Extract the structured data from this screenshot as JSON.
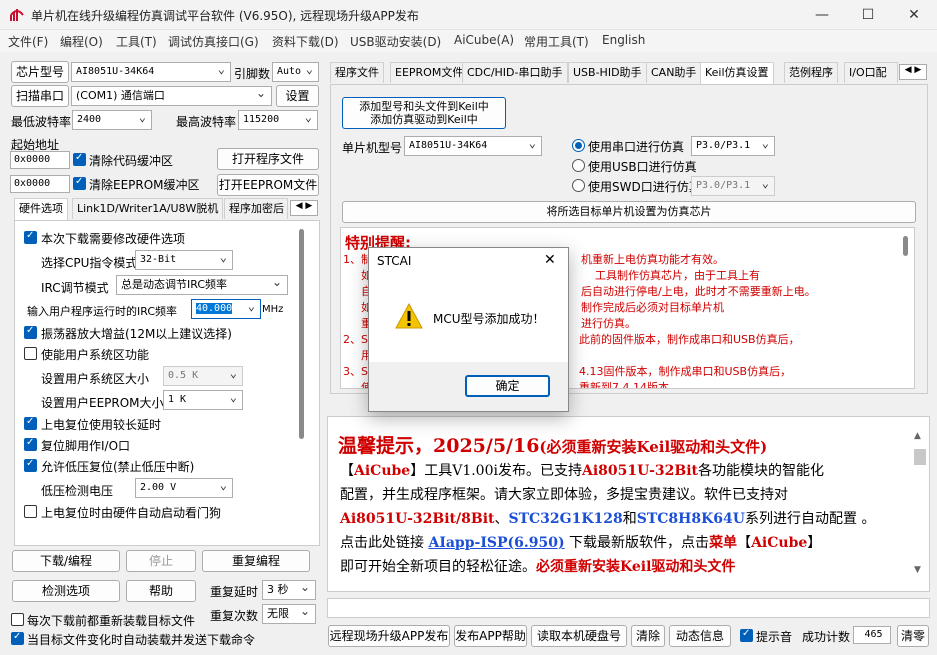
{
  "window": {
    "title": "单片机在线升级编程仿真调试平台软件 (V6.95O), 远程现场升级APP发布",
    "minimize": "—",
    "maximize": "☐",
    "close": "✕"
  },
  "menu": [
    "文件(F)",
    "编程(O)",
    "工具(T)",
    "调试仿真接口(G)",
    "资料下载(D)",
    "USB驱动安装(D)",
    "AiCube(A)",
    "常用工具(T)",
    "English"
  ],
  "left": {
    "chip_label": "芯片型号",
    "chip_value": "AI8051U-34K64",
    "pin_label": "引脚数",
    "pin_value": "Auto",
    "scan_button": "扫描串口",
    "port_value": "(COM1) 通信端口",
    "settings_button": "设置",
    "min_baud_label": "最低波特率",
    "min_baud_value": "2400",
    "max_baud_label": "最高波特率",
    "max_baud_value": "115200",
    "start_addr_label": "起始地址",
    "code_addr": "0x0000",
    "clear_code": "清除代码缓冲区",
    "open_prog": "打开程序文件",
    "eeprom_addr": "0x0000",
    "clear_eeprom": "清除EEPROM缓冲区",
    "open_eeprom": "打开EEPROM文件",
    "tabs": [
      "硬件选项",
      "Link1D/Writer1A/U8W脱机",
      "程序加密后"
    ],
    "hw": {
      "modify_hw": "本次下载需要修改硬件选项",
      "cpu_label": "选择CPU指令模式",
      "cpu_value": "32-Bit",
      "irc_mode_label": "IRC调节模式",
      "irc_mode_value": "总是动态调节IRC频率",
      "irc_freq_label": "输入用户程序运行时的IRC频率",
      "irc_freq_value": "40.000",
      "mhz": "MHz",
      "osc_gain": "振荡器放大增益(12M以上建议选择)",
      "user_sys": "使能用户系统区功能",
      "sys_size_label": "设置用户系统区大小",
      "sys_size_value": "0.5 K",
      "eeprom_size_label": "设置用户EEPROM大小",
      "eeprom_size_value": "1   K",
      "long_delay": "上电复位使用较长延时",
      "reset_io": "复位脚用作I/O口",
      "lvr": "允许低压复位(禁止低压中断)",
      "lvd_label": "低压检测电压",
      "lvd_value": "2.00 V",
      "wdt": "上电复位时由硬件自动启动看门狗"
    },
    "download_button": "下载/编程",
    "stop_button": "停止",
    "reprogram_button": "重复编程",
    "check_button": "检测选项",
    "help_button": "帮助",
    "repeat_delay_label": "重复延时",
    "repeat_delay_value": "3 秒",
    "repeat_count_label": "重复次数",
    "repeat_count_value": "无限",
    "reload_cb": "每次下载前都重新装载目标文件",
    "auto_cb": "当目标文件变化时自动装载并发送下载命令"
  },
  "right_tabs": [
    "程序文件",
    "EEPROM文件",
    "CDC/HID-串口助手",
    "USB-HID助手",
    "CAN助手",
    "Keil仿真设置",
    "范例程序",
    "I/O口配"
  ],
  "keil": {
    "add_button_line1": "添加型号和头文件到Keil中",
    "add_button_line2": "添加仿真驱动到Keil中",
    "mcu_label": "单片机型号",
    "mcu_value": "AI8051U-34K64",
    "serial_radio": "使用串口进行仿真",
    "serial_value": "P3.0/P3.1",
    "usb_radio": "使用USB口进行仿真",
    "swd_radio": "使用SWD口进行仿真",
    "swd_value": "P3.0/P3.1",
    "set_chip_button": "将所选目标单片机设置为仿真芯片",
    "notice_title": "特别提醒:",
    "notice_lines": [
      "1、制",
      "如",
      "自",
      "如",
      "重",
      "2、ST",
      "用",
      "3、ST",
      "使"
    ],
    "notice_right": [
      "机重新上电仿真功能才有效。",
      "工具制作仿真芯片，由于工具上有",
      "后自动进行停电/上电，此时才不需要重新上电。",
      "制作完成后必须对目标单片机",
      "进行仿真。",
      "此前的固件版本，制作成串口和USB仿真后，",
      "4.13固件版本，制作成串口和USB仿真后，",
      "重新到7.4.14版本"
    ]
  },
  "info": {
    "title": "温馨提示，2025/5/16",
    "title_paren": "(必须重新安装Keil驱动和头文件)",
    "p1a": "【",
    "aicube": "AiCube",
    "p1b": "】工具V1.00i发布。已支持",
    "ai8051": "Ai8051U-32Bit",
    "p1c": "各功能模块的智能化",
    "p2": "配置，并生成程序框架。请大家立即体验，多提宝贵建议。软件已支持对",
    "p3a": "Ai8051U-32Bit/8Bit",
    "p3b": "、",
    "stc32": "STC32G1K128",
    "p3c": "和",
    "stc8": "STC8H8K64U",
    "p3d": "系列进行自动配置 。",
    "p4a": "点击此处链接 ",
    "link": "AIapp-ISP(6.950)",
    "p4b": " 下载最新版软件，点击",
    "menu_word": "菜单",
    "p4c": "【",
    "aicube2": "AiCube",
    "p4d": "】",
    "p5a": "即可开始全新项目的轻松征途。",
    "p5b": "必须重新安装Keil驱动和头文件"
  },
  "bottom": {
    "remote": "远程现场升级APP发布",
    "publish_help": "发布APP帮助",
    "read_disk": "读取本机硬盘号",
    "clear": "清除",
    "status": "动态信息",
    "beep": "提示音",
    "success_label": "成功计数",
    "success_value": "465",
    "reset": "清零"
  },
  "dialog": {
    "title": "STCAI",
    "message": "MCU型号添加成功！",
    "ok": "确定",
    "close": "✕"
  }
}
